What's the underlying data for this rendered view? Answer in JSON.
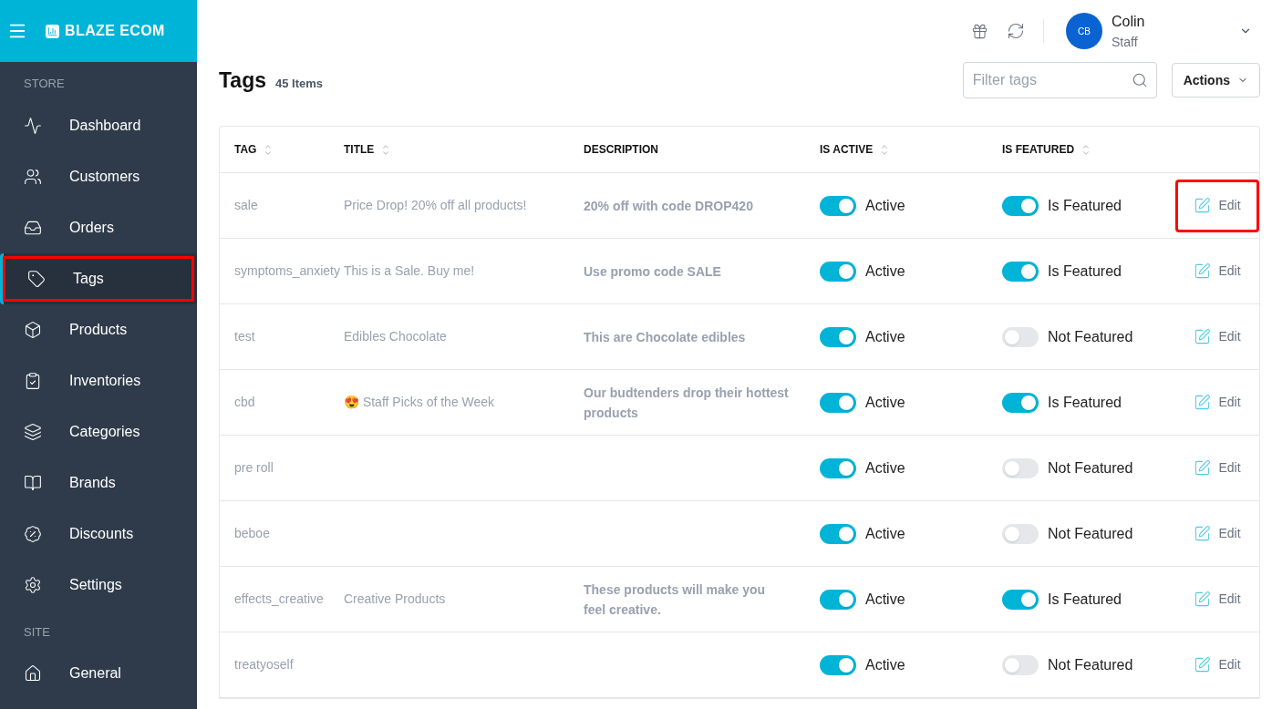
{
  "brand": {
    "name": "BLAZE ECOM"
  },
  "sidebar": {
    "sections": [
      {
        "label": "STORE",
        "items": [
          {
            "label": "Dashboard",
            "selected": false,
            "highlighted": false
          },
          {
            "label": "Customers",
            "selected": false,
            "highlighted": false
          },
          {
            "label": "Orders",
            "selected": false,
            "highlighted": false
          },
          {
            "label": "Tags",
            "selected": true,
            "highlighted": true
          },
          {
            "label": "Products",
            "selected": false,
            "highlighted": false
          },
          {
            "label": "Inventories",
            "selected": false,
            "highlighted": false
          },
          {
            "label": "Categories",
            "selected": false,
            "highlighted": false
          },
          {
            "label": "Brands",
            "selected": false,
            "highlighted": false
          },
          {
            "label": "Discounts",
            "selected": false,
            "highlighted": false
          },
          {
            "label": "Settings",
            "selected": false,
            "highlighted": false
          }
        ]
      },
      {
        "label": "SITE",
        "items": [
          {
            "label": "General",
            "selected": false,
            "highlighted": false
          }
        ]
      }
    ]
  },
  "user": {
    "initials": "CB",
    "name": "Colin",
    "role": "Staff"
  },
  "page": {
    "title": "Tags",
    "count": "45 Items",
    "search": {
      "placeholder": "Filter tags"
    },
    "actions_button": "Actions"
  },
  "table": {
    "columns": [
      {
        "label": "TAG",
        "sortable": true
      },
      {
        "label": "TITLE",
        "sortable": true
      },
      {
        "label": "DESCRIPTION",
        "sortable": false
      },
      {
        "label": "IS ACTIVE",
        "sortable": true
      },
      {
        "label": "IS FEATURED",
        "sortable": true
      }
    ],
    "rows": [
      {
        "tag": "sale",
        "title": "Price Drop! 20% off all products!",
        "description": "20% off with code DROP420",
        "active": true,
        "active_label": "Active",
        "featured": true,
        "featured_label": "Is Featured",
        "edit": "Edit",
        "highlighted": true
      },
      {
        "tag": "symptoms_anxiety",
        "title": "This is a Sale. Buy me!",
        "description": "Use promo code SALE",
        "active": true,
        "active_label": "Active",
        "featured": true,
        "featured_label": "Is Featured",
        "edit": "Edit",
        "highlighted": false
      },
      {
        "tag": "test",
        "title": "Edibles Chocolate",
        "description": "This are Chocolate edibles",
        "active": true,
        "active_label": "Active",
        "featured": false,
        "featured_label": "Not Featured",
        "edit": "Edit",
        "highlighted": false
      },
      {
        "tag": "cbd",
        "title": "😍 Staff Picks of the Week",
        "description": "Our budtenders drop their hottest products",
        "active": true,
        "active_label": "Active",
        "featured": true,
        "featured_label": "Is Featured",
        "edit": "Edit",
        "highlighted": false
      },
      {
        "tag": "pre roll",
        "active": true,
        "active_label": "Active",
        "featured": false,
        "featured_label": "Not Featured",
        "edit": "Edit",
        "highlighted": false
      },
      {
        "tag": "beboe",
        "active": true,
        "active_label": "Active",
        "featured": false,
        "featured_label": "Not Featured",
        "edit": "Edit",
        "highlighted": false
      },
      {
        "tag": "effects_creative",
        "title": "Creative Products",
        "description": "These products will make you feel creative.",
        "active": true,
        "active_label": "Active",
        "featured": true,
        "featured_label": "Is Featured",
        "edit": "Edit",
        "highlighted": false
      },
      {
        "tag": "treatyoself",
        "active": true,
        "active_label": "Active",
        "featured": false,
        "featured_label": "Not Featured",
        "edit": "Edit",
        "highlighted": false
      }
    ]
  }
}
